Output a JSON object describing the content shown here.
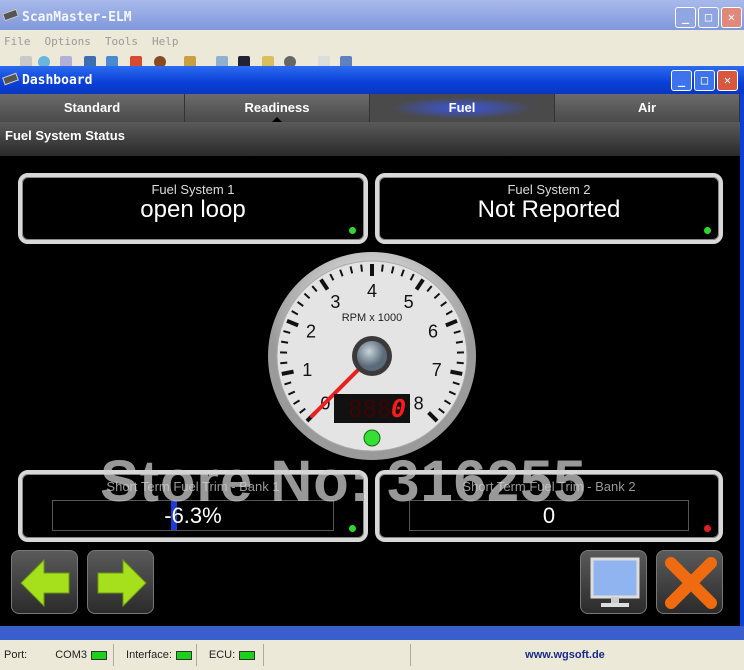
{
  "app": {
    "title": "ScanMaster-ELM",
    "menu": [
      "File",
      "Options",
      "Tools",
      "Help"
    ]
  },
  "dashboard": {
    "title": "Dashboard",
    "tabs": [
      {
        "label": "Standard"
      },
      {
        "label": "Readiness"
      },
      {
        "label": "Fuel",
        "active": true
      },
      {
        "label": "Air"
      }
    ],
    "section_title": "Fuel System Status",
    "fuel_system_1": {
      "label": "Fuel System 1",
      "value": "open loop",
      "led": "#2fd82f"
    },
    "fuel_system_2": {
      "label": "Fuel System 2",
      "value": "Not Reported",
      "led": "#2fd82f"
    },
    "gauge": {
      "unit_label": "RPM x 1000",
      "min": 0,
      "max": 8,
      "value": 0,
      "digital": "0",
      "ticks": [
        "0",
        "1",
        "2",
        "3",
        "4",
        "5",
        "6",
        "7",
        "8"
      ]
    },
    "stft_bank1": {
      "label": "Short Term Fuel Trim - Bank 1",
      "value": "-6.3%",
      "percent": -6.3,
      "led": "#2fd82f"
    },
    "stft_bank2": {
      "label": "Short Term Fuel Trim - Bank 2",
      "value": "0",
      "led": "#e02020"
    }
  },
  "watermark": "Store No: 316255",
  "status": {
    "port_label": "Port:",
    "port_value": "COM3",
    "interface_label": "Interface:",
    "ecu_label": "ECU:",
    "website": "www.wgsoft.de"
  }
}
